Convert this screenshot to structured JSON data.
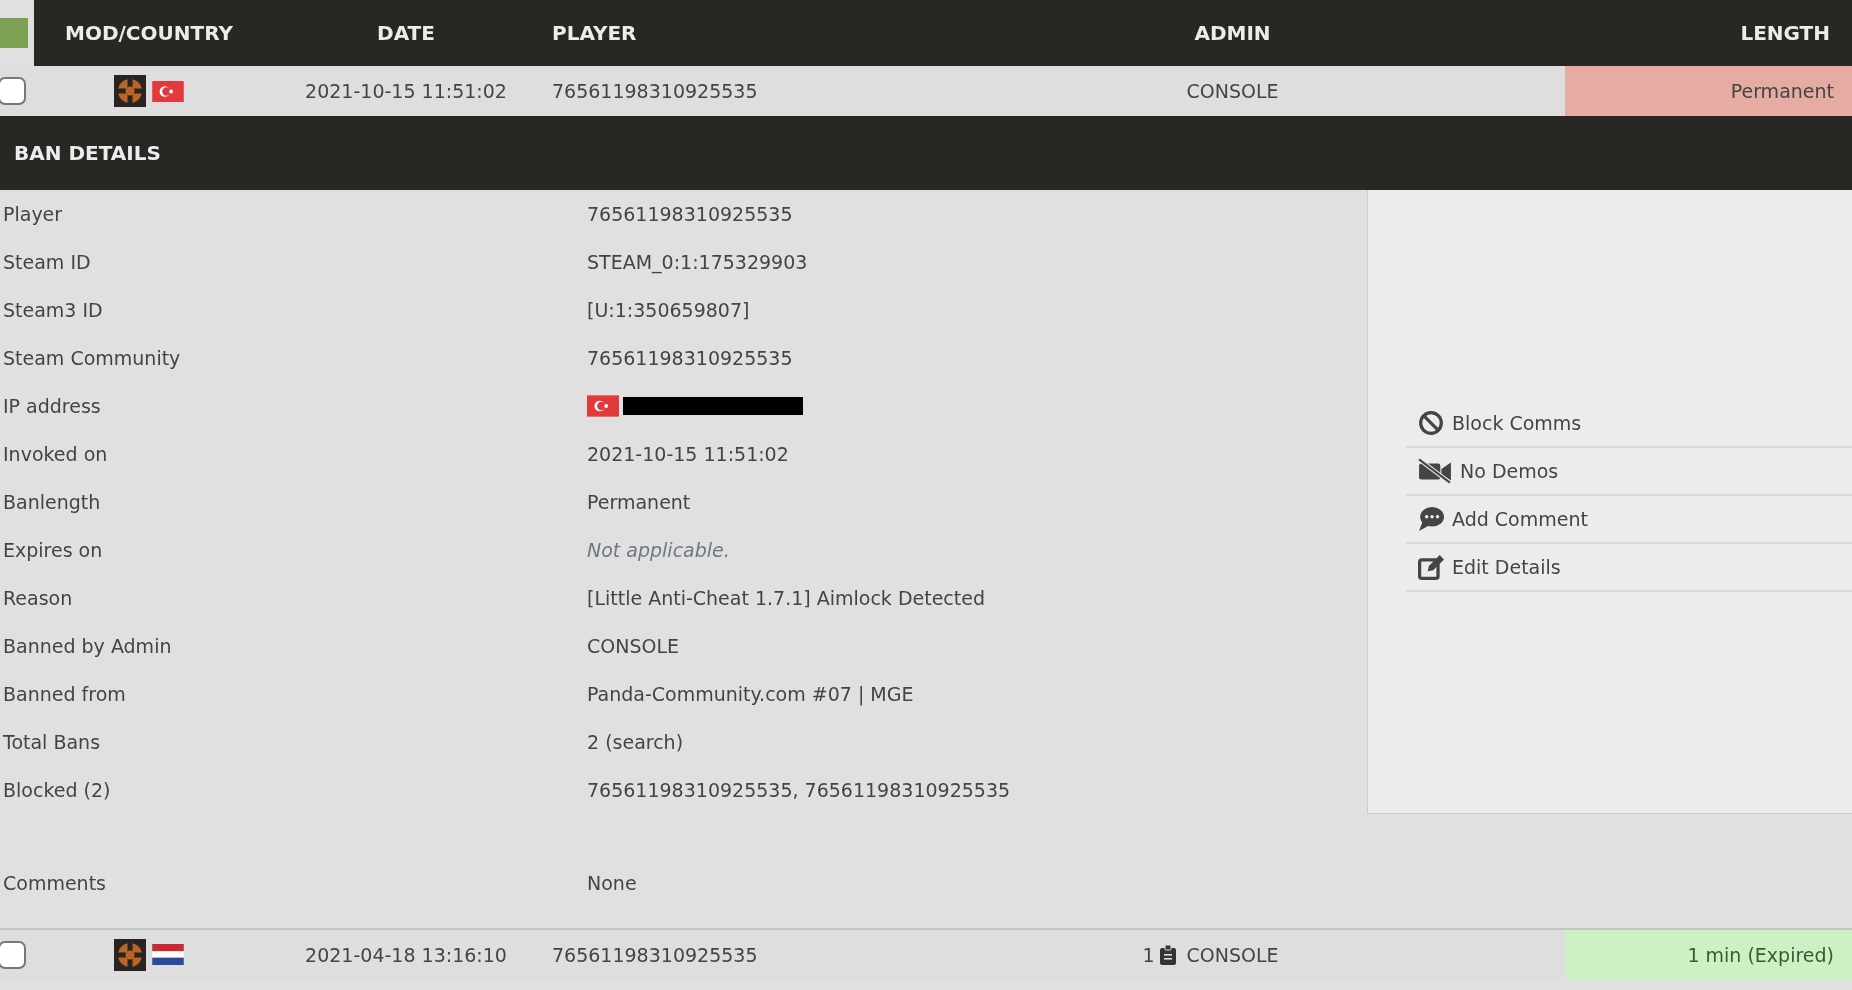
{
  "table": {
    "columns": [
      "MOD/COUNTRY",
      "DATE",
      "PLAYER",
      "ADMIN",
      "LENGTH"
    ],
    "rows": [
      {
        "checked": false,
        "flag": {
          "kind": "tr"
        },
        "date": "2021-10-15 11:51:02",
        "player": "76561198310925535",
        "admin": "CONSOLE",
        "length": "Permanent",
        "expired": false,
        "expanded": true
      },
      {
        "checked": false,
        "flag": {
          "kind": "nl"
        },
        "date": "2021-04-18 13:16:10",
        "player": "76561198310925535",
        "comments": "1",
        "admin": "CONSOLE",
        "length": "1 min (Expired)",
        "expired": true,
        "expanded": false
      }
    ]
  },
  "ban_details": {
    "title": "BAN DETAILS",
    "fields": [
      {
        "label": "Player",
        "kind": "text",
        "value": "76561198310925535"
      },
      {
        "label": "Steam ID",
        "kind": "text",
        "value": "STEAM_0:1:175329903"
      },
      {
        "label": "Steam3 ID",
        "kind": "text",
        "value": "[U:1:350659807]"
      },
      {
        "label": "Steam Community",
        "kind": "text",
        "value": "76561198310925535"
      },
      {
        "label": "IP address",
        "kind": "ip",
        "flag": {
          "kind": "tr"
        },
        "redacted": true
      },
      {
        "label": "Invoked on",
        "kind": "text",
        "value": "2021-10-15 11:51:02"
      },
      {
        "label": "Banlength",
        "kind": "text",
        "value": "Permanent"
      },
      {
        "label": "Expires on",
        "kind": "note",
        "value": "Not applicable."
      },
      {
        "label": "Reason",
        "kind": "text",
        "value": "[Little Anti-Cheat 1.7.1] Aimlock Detected"
      },
      {
        "label": "Banned by Admin",
        "kind": "text",
        "value": "CONSOLE"
      },
      {
        "label": "Banned from",
        "kind": "text",
        "value": "Panda-Community.com #07 | MGE"
      },
      {
        "label": "Total Bans",
        "kind": "text",
        "value": "2 (search)"
      },
      {
        "label": "Blocked (2)",
        "kind": "text",
        "value": "76561198310925535, 76561198310925535"
      }
    ],
    "comments": {
      "label": "Comments",
      "value": "None"
    },
    "actions": [
      {
        "kind": "block",
        "label": "Block Comms"
      },
      {
        "kind": "demos",
        "label": "No Demos"
      },
      {
        "kind": "comment",
        "label": "Add Comment"
      },
      {
        "kind": "edit",
        "label": "Edit Details"
      }
    ]
  }
}
